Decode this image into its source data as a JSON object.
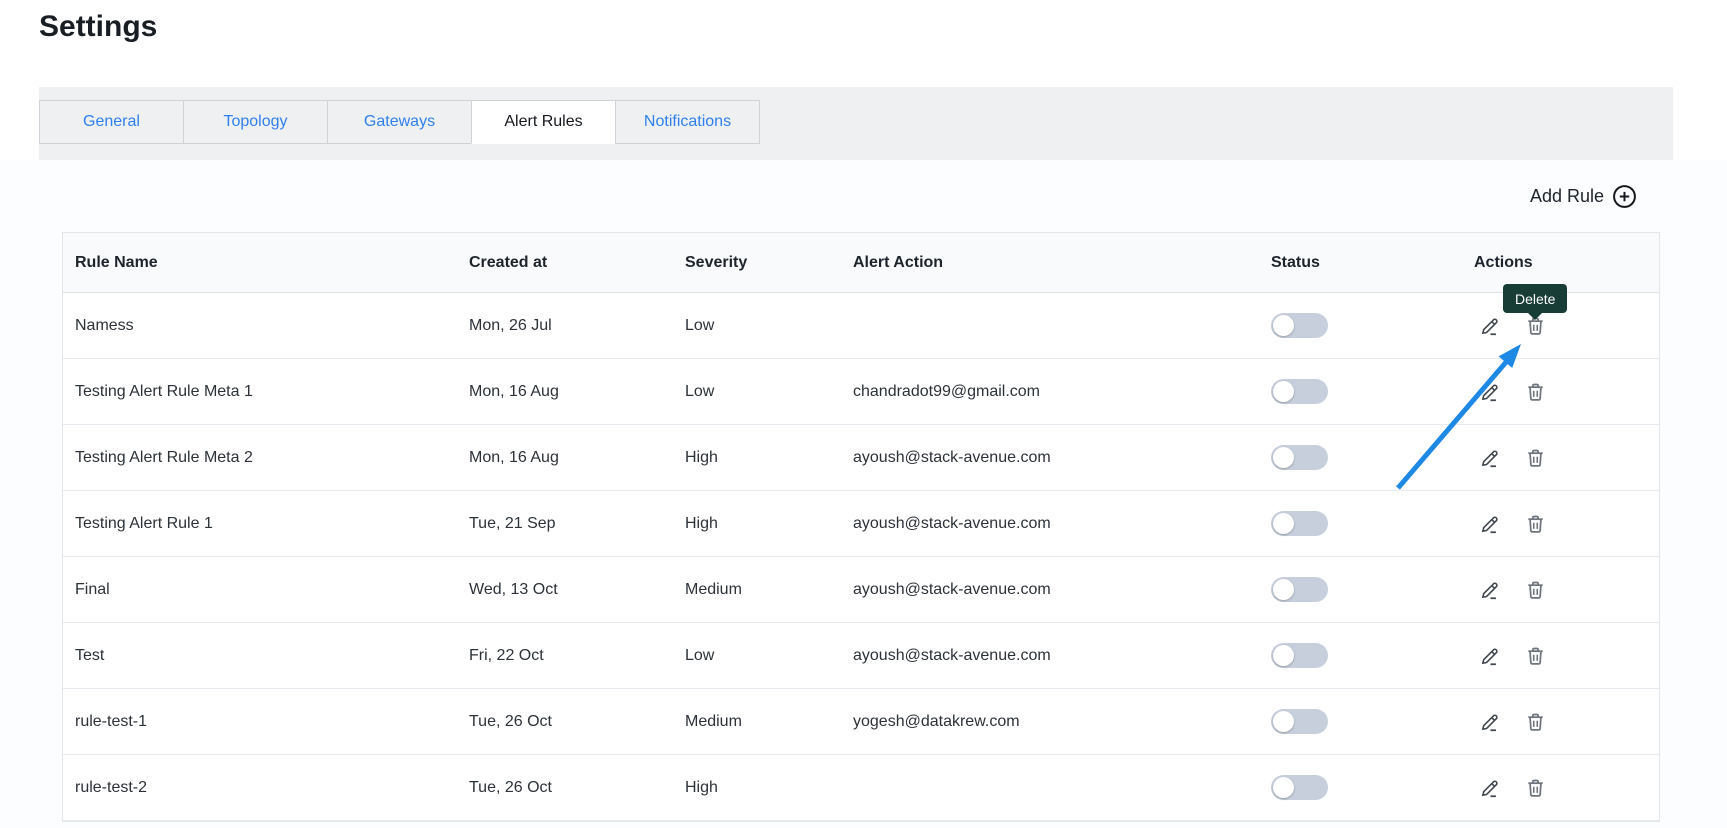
{
  "page": {
    "title": "Settings"
  },
  "tabs": [
    {
      "label": "General",
      "active": false
    },
    {
      "label": "Topology",
      "active": false
    },
    {
      "label": "Gateways",
      "active": false
    },
    {
      "label": "Alert Rules",
      "active": true
    },
    {
      "label": "Notifications",
      "active": false
    }
  ],
  "toolbar": {
    "add_rule_label": "Add Rule",
    "add_rule_icon": "plus-circle-icon"
  },
  "table": {
    "columns": [
      "Rule Name",
      "Created at",
      "Severity",
      "Alert Action",
      "Status",
      "Actions"
    ],
    "rows": [
      {
        "name": "Namess",
        "created_at": "Mon, 26 Jul",
        "severity": "Low",
        "alert_action": "",
        "status_enabled": false
      },
      {
        "name": "Testing Alert Rule Meta 1",
        "created_at": "Mon, 16 Aug",
        "severity": "Low",
        "alert_action": "chandradot99@gmail.com",
        "status_enabled": false
      },
      {
        "name": "Testing Alert Rule Meta 2",
        "created_at": "Mon, 16 Aug",
        "severity": "High",
        "alert_action": "ayoush@stack-avenue.com",
        "status_enabled": false
      },
      {
        "name": "Testing Alert Rule 1",
        "created_at": "Tue, 21 Sep",
        "severity": "High",
        "alert_action": "ayoush@stack-avenue.com",
        "status_enabled": false
      },
      {
        "name": "Final",
        "created_at": "Wed, 13 Oct",
        "severity": "Medium",
        "alert_action": "ayoush@stack-avenue.com",
        "status_enabled": false
      },
      {
        "name": "Test",
        "created_at": "Fri, 22 Oct",
        "severity": "Low",
        "alert_action": "ayoush@stack-avenue.com",
        "status_enabled": false
      },
      {
        "name": "rule-test-1",
        "created_at": "Tue, 26 Oct",
        "severity": "Medium",
        "alert_action": "yogesh@datakrew.com",
        "status_enabled": false
      },
      {
        "name": "rule-test-2",
        "created_at": "Tue, 26 Oct",
        "severity": "High",
        "alert_action": "",
        "status_enabled": false
      }
    ],
    "row_action_icons": [
      "pencil-icon",
      "trash-icon"
    ]
  },
  "tooltip": {
    "label": "Delete"
  },
  "colors": {
    "tab_link_blue": "#2f80ed",
    "active_tab_text": "#15181c",
    "tooltip_bg": "#183c36",
    "toggle_track_off": "#c6cfdb",
    "annotation_arrow_blue": "#1e88e5",
    "action_icon_gray": "#6f757c",
    "table_border": "#e3e6ea"
  }
}
